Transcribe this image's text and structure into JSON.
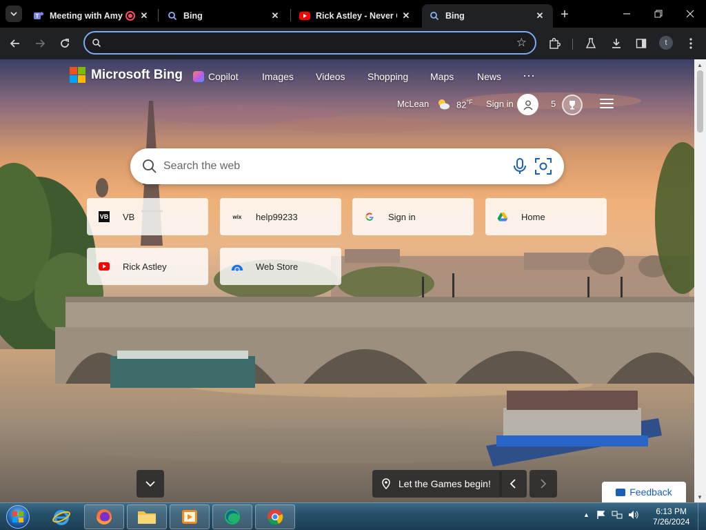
{
  "browser": {
    "tabs": [
      {
        "title": "Meeting with Amy",
        "icon": "teams-icon",
        "recording": true
      },
      {
        "title": "Bing",
        "icon": "bing-search-icon"
      },
      {
        "title": "Rick Astley - Never Gonna Give You Up",
        "icon": "youtube-icon"
      },
      {
        "title": "Bing",
        "icon": "bing-search-icon",
        "active": true
      }
    ],
    "address_value": "",
    "accent_color": "#7cacf8",
    "profile_initial": "t"
  },
  "bing": {
    "brand": "Microsoft Bing",
    "nav": {
      "copilot": "Copilot",
      "images": "Images",
      "videos": "Videos",
      "shopping": "Shopping",
      "maps": "Maps",
      "news": "News",
      "more": "···"
    },
    "location": "McLean",
    "temperature": "82",
    "temp_unit": "°F",
    "sign_in": "Sign in",
    "rewards_points": "5",
    "search_placeholder": "Search the web",
    "quick_links": [
      {
        "label": "VB",
        "icon_text": "VB"
      },
      {
        "label": "help99233",
        "icon_text": "wix"
      },
      {
        "label": "Sign in",
        "icon_text": "G"
      },
      {
        "label": "Home",
        "icon_text": "drive"
      },
      {
        "label": "Rick Astley",
        "icon_text": "youtube"
      },
      {
        "label": "Web Store",
        "icon_text": "webstore"
      }
    ],
    "caption": "Let the Games begin!",
    "feedback": "Feedback"
  },
  "taskbar": {
    "time": "6:13 PM",
    "date": "7/26/2024"
  }
}
